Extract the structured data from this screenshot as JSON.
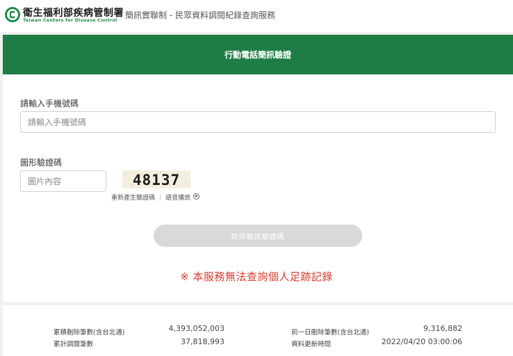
{
  "header": {
    "logo_main": "衛生福利部疾病管制署",
    "logo_sub": "Taiwan Centers for Disease Control",
    "service_title": "簡訊實聯制 - 民眾資料調閱紀錄查詢服務"
  },
  "banner": {
    "title": "行動電話簡訊驗證"
  },
  "form": {
    "phone_label": "請輸入手機號碼",
    "phone_placeholder": "請輸入手機號碼",
    "captcha_label": "圖形驗證碼",
    "captcha_placeholder": "圖片內容",
    "captcha_code": "48137",
    "regenerate_label": "重新產生驗證碼",
    "audio_label": "語音播放",
    "submit_label": "取得簡訊驗證碼"
  },
  "notice": "※ 本服務無法查詢個人足跡記錄",
  "stats": {
    "cumulative_deleted_label": "累積刪除筆數(含台北通)",
    "cumulative_deleted_value": "4,393,052,003",
    "cumulative_viewed_label": "累計調閱筆數",
    "cumulative_viewed_value": "37,818,993",
    "prev_day_deleted_label": "前一日刪除筆數(含台北通)",
    "prev_day_deleted_value": "9,316,882",
    "updated_label": "資料更新時間",
    "updated_value": "2022/04/20 03:00:06"
  },
  "colors": {
    "brand_green": "#1e7d45",
    "notice_red": "#d93a2b",
    "button_disabled": "#d9d9d9"
  }
}
